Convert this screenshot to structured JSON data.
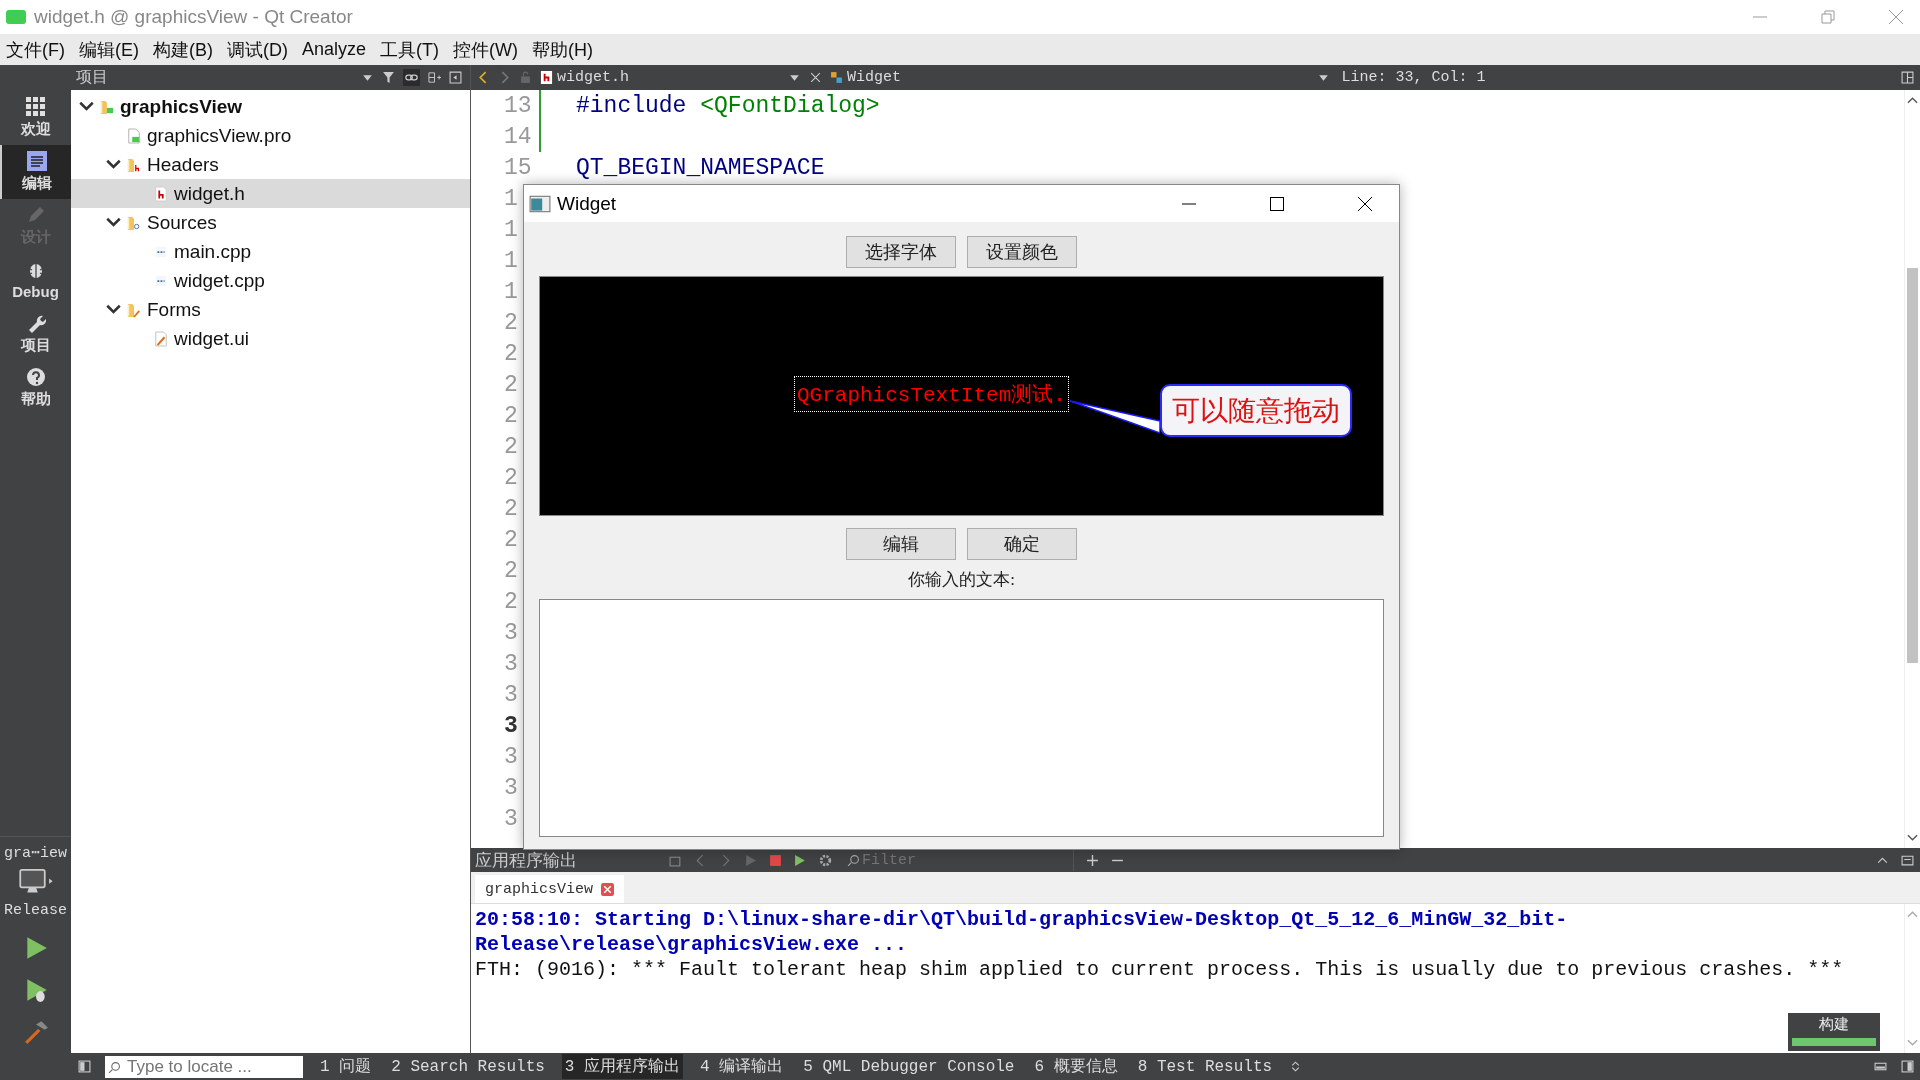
{
  "window": {
    "title": "widget.h @ graphicsView - Qt Creator"
  },
  "menu": [
    "文件(F)",
    "编辑(E)",
    "构建(B)",
    "调试(D)",
    "Analyze",
    "工具(T)",
    "控件(W)",
    "帮助(H)"
  ],
  "modes": [
    {
      "label": "欢迎",
      "kind": "welcome",
      "selected": false,
      "disabled": false
    },
    {
      "label": "编辑",
      "kind": "edit",
      "selected": true,
      "disabled": false
    },
    {
      "label": "设计",
      "kind": "design",
      "selected": false,
      "disabled": true
    },
    {
      "label": "Debug",
      "kind": "debug",
      "selected": false,
      "disabled": false
    },
    {
      "label": "项目",
      "kind": "projects",
      "selected": false,
      "disabled": false
    },
    {
      "label": "帮助",
      "kind": "help",
      "selected": false,
      "disabled": false
    }
  ],
  "target": {
    "project": "gra⋯iew",
    "config": "Release"
  },
  "project_panel": {
    "title": "项目",
    "tree": [
      {
        "label": "graphicsView",
        "kind": "project",
        "expanded": true,
        "selected": false,
        "children": [
          {
            "label": "graphicsView.pro",
            "kind": "pro",
            "selected": false
          },
          {
            "label": "Headers",
            "kind": "headers",
            "expanded": true,
            "selected": false,
            "children": [
              {
                "label": "widget.h",
                "kind": "header",
                "selected": true
              }
            ]
          },
          {
            "label": "Sources",
            "kind": "sources",
            "expanded": true,
            "selected": false,
            "children": [
              {
                "label": "main.cpp",
                "kind": "source",
                "selected": false
              },
              {
                "label": "widget.cpp",
                "kind": "source",
                "selected": false
              }
            ]
          },
          {
            "label": "Forms",
            "kind": "forms",
            "expanded": true,
            "selected": false,
            "children": [
              {
                "label": "widget.ui",
                "kind": "form",
                "selected": false
              }
            ]
          }
        ]
      }
    ]
  },
  "editor": {
    "file_tab": "widget.h",
    "symbol": "Widget",
    "position": "Line: 33, Col: 1",
    "lines": [
      {
        "number": "13",
        "current": false,
        "changed": true,
        "code": [
          {
            "text": "#include ",
            "kind": "preproc"
          },
          {
            "text": "<QFontDialog>",
            "kind": "string"
          }
        ]
      },
      {
        "number": "14",
        "current": false,
        "changed": true
      },
      {
        "number": "15",
        "current": false,
        "changed": false,
        "code": [
          {
            "text": "QT_BEGIN_NAMESPACE",
            "kind": "macro"
          }
        ]
      },
      {
        "number": "1",
        "current": false
      },
      {
        "number": "1",
        "current": false
      },
      {
        "number": "1",
        "current": false
      },
      {
        "number": "1",
        "current": false
      },
      {
        "number": "2",
        "current": false
      },
      {
        "number": "2",
        "current": false
      },
      {
        "number": "2",
        "current": false
      },
      {
        "number": "2",
        "current": false
      },
      {
        "number": "2",
        "current": false
      },
      {
        "number": "2",
        "current": false
      },
      {
        "number": "2",
        "current": false
      },
      {
        "number": "2",
        "current": false
      },
      {
        "number": "2",
        "current": false
      },
      {
        "number": "2",
        "current": false
      },
      {
        "number": "3",
        "current": false
      },
      {
        "number": "3",
        "current": false
      },
      {
        "number": "3",
        "current": false
      },
      {
        "number": "3",
        "current": true
      },
      {
        "number": "3",
        "current": false
      },
      {
        "number": "3",
        "current": false
      },
      {
        "number": "3",
        "current": false
      }
    ]
  },
  "dialog": {
    "title": "Widget",
    "top_buttons": [
      "选择字体",
      "设置颜色"
    ],
    "scene": {
      "text_item": "QGraphicsTextItem测试.",
      "callout": "可以随意拖动"
    },
    "bottom_buttons": [
      "编辑",
      "确定"
    ],
    "label": "你输入的文本:"
  },
  "output": {
    "title": "应用程序输出",
    "filter_placeholder": "Filter",
    "tab": "graphicsView",
    "lines": [
      {
        "text": "20:58:10: Starting D:\\linux-share-dir\\QT\\build-graphicsView-Desktop_Qt_5_12_6_MinGW_32_bit-",
        "kind": "info"
      },
      {
        "text": "Release\\release\\graphicsView.exe ...",
        "kind": "info"
      },
      {
        "text": "FTH: (9016): *** Fault tolerant heap shim applied to current process. This is usually due to previous crashes. ***",
        "kind": "plain"
      }
    ]
  },
  "build": {
    "label": "构建",
    "level": 1
  },
  "status_bar": {
    "locator_placeholder": "Type to locate ...",
    "panes": [
      {
        "label": "1 问题",
        "selected": false
      },
      {
        "label": "2 Search Results",
        "selected": false
      },
      {
        "label": "3 应用程序输出",
        "selected": true
      },
      {
        "label": "4 编译输出",
        "selected": false
      },
      {
        "label": "5 QML Debugger Console",
        "selected": false
      },
      {
        "label": "6 概要信息",
        "selected": false
      },
      {
        "label": "8 Test Results",
        "selected": false
      }
    ]
  }
}
